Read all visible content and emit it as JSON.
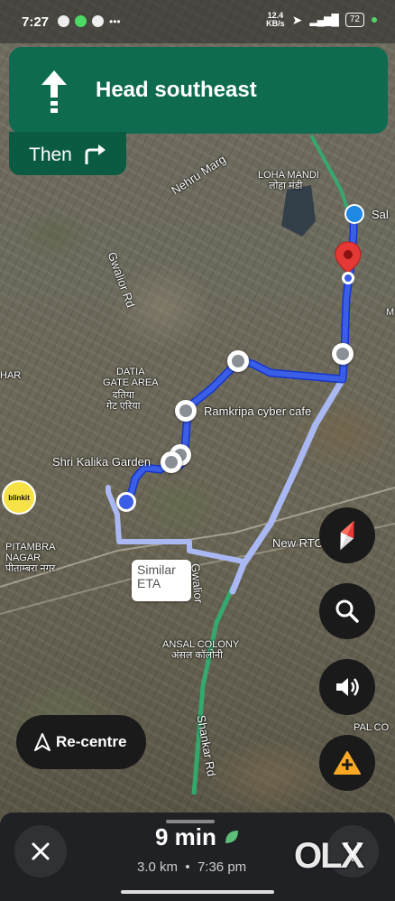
{
  "status_bar": {
    "time": "7:27",
    "speed_value": "12.4",
    "speed_unit": "KB/s",
    "battery": "72"
  },
  "banner": {
    "instruction": "Head southeast",
    "then_label": "Then"
  },
  "map_labels": {
    "nehru_marg": "Nehru Marg",
    "loha_mandi": "LOHA MANDI",
    "loha_mandi_hi": "लोहा मंडी",
    "gwalior_rd": "Gwalior Rd",
    "datia_gate": "DATIA\nGATE AREA",
    "datia_gate_hi": "दतिया\nगेट एरिया",
    "har": "HAR",
    "ramkripa": "Ramkripa cyber cafe",
    "shri_kalika": "Shri Kalika Garden",
    "pitambra": "PITAMBRA\nNAGAR",
    "pitambra_hi": "पीताम्बरा नगर",
    "new_rto": "New RTO",
    "ansal": "ANSAL COLONY",
    "ansal_hi": "अंसल कॉलोनी",
    "shankar_rd": "Shankar Rd",
    "gwalior_rd_lower": "Gwalior",
    "pal_colony": "PAL CO",
    "sal": "Sal",
    "m": "M"
  },
  "similar_eta": "Similar\nETA",
  "recentre_label": "Re-centre",
  "bottom": {
    "eta_time": "9 min",
    "distance": "3.0 km",
    "arrival": "7:36 pm"
  },
  "blinkit": "blinkit",
  "watermark": "OLX",
  "colors": {
    "banner": "#0f6b4f",
    "route_primary": "#3a5ee6",
    "route_alt": "#a9b8f2",
    "destination": "#e53935"
  }
}
